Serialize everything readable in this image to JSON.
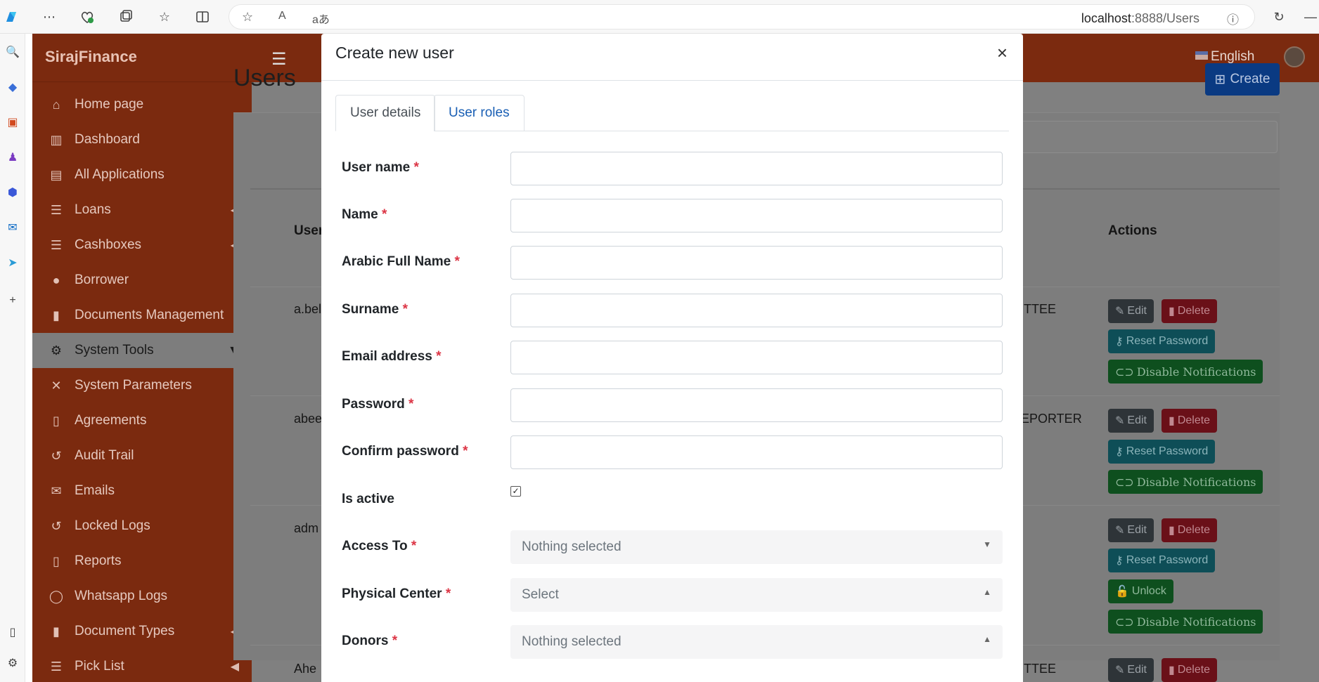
{
  "browser": {
    "url_host": "localhost",
    "url_rest": ":8888/Users",
    "read_aloud": "A",
    "translate": "aあ"
  },
  "app": {
    "brand": "SirajFinance",
    "language": "English",
    "page_title": "Users",
    "create_label": "Create"
  },
  "sidebar": {
    "items": [
      {
        "label": "Home page",
        "icon": "home-icon"
      },
      {
        "label": "Dashboard",
        "icon": "chart-icon"
      },
      {
        "label": "All Applications",
        "icon": "table-icon"
      },
      {
        "label": "Loans",
        "icon": "list-icon"
      },
      {
        "label": "Cashboxes",
        "icon": "list-icon"
      },
      {
        "label": "Borrower",
        "icon": "user-icon"
      },
      {
        "label": "Documents Management",
        "icon": "file-icon"
      },
      {
        "label": "System Tools",
        "icon": "gear-icon"
      },
      {
        "label": "System Parameters",
        "icon": "tools-icon"
      },
      {
        "label": "Agreements",
        "icon": "file-code-icon"
      },
      {
        "label": "Audit Trail",
        "icon": "history-icon"
      },
      {
        "label": "Emails",
        "icon": "envelope-icon"
      },
      {
        "label": "Locked Logs",
        "icon": "history-icon"
      },
      {
        "label": "Reports",
        "icon": "file-excel-icon"
      },
      {
        "label": "Whatsapp Logs",
        "icon": "whatsapp-icon"
      },
      {
        "label": "Document Types",
        "icon": "file-icon"
      },
      {
        "label": "Pick List",
        "icon": "list-icon"
      }
    ]
  },
  "table": {
    "headers": [
      "User",
      "Actions"
    ],
    "rows": [
      {
        "user": "a.bel",
        "role": "TTEE"
      },
      {
        "user": "abee",
        "role": "EPORTER"
      },
      {
        "user": "adm",
        "role": ""
      },
      {
        "user": "Ahe",
        "role": "TTEE"
      }
    ],
    "actions": {
      "edit": "Edit",
      "delete": "Delete",
      "reset": "Reset Password",
      "notif": "Disable Notifications",
      "unlock": "Unlock"
    }
  },
  "modal": {
    "title": "Create new user",
    "close": "×",
    "tabs": [
      "User details",
      "User roles"
    ],
    "fields": {
      "username": "User name",
      "name": "Name",
      "arabic": "Arabic Full Name",
      "surname": "Surname",
      "email": "Email address",
      "password": "Password",
      "confirm": "Confirm password",
      "active": "Is active",
      "access": "Access To",
      "physical": "Physical Center",
      "donors": "Donors"
    },
    "required_mark": "*",
    "is_active_checked": true,
    "selects": {
      "access": "Nothing selected",
      "physical": "Select",
      "donors": "Nothing selected"
    }
  },
  "colors": {
    "brand_red": "#c0391a",
    "primary_blue": "#0d6efd",
    "danger": "#dc3545"
  }
}
